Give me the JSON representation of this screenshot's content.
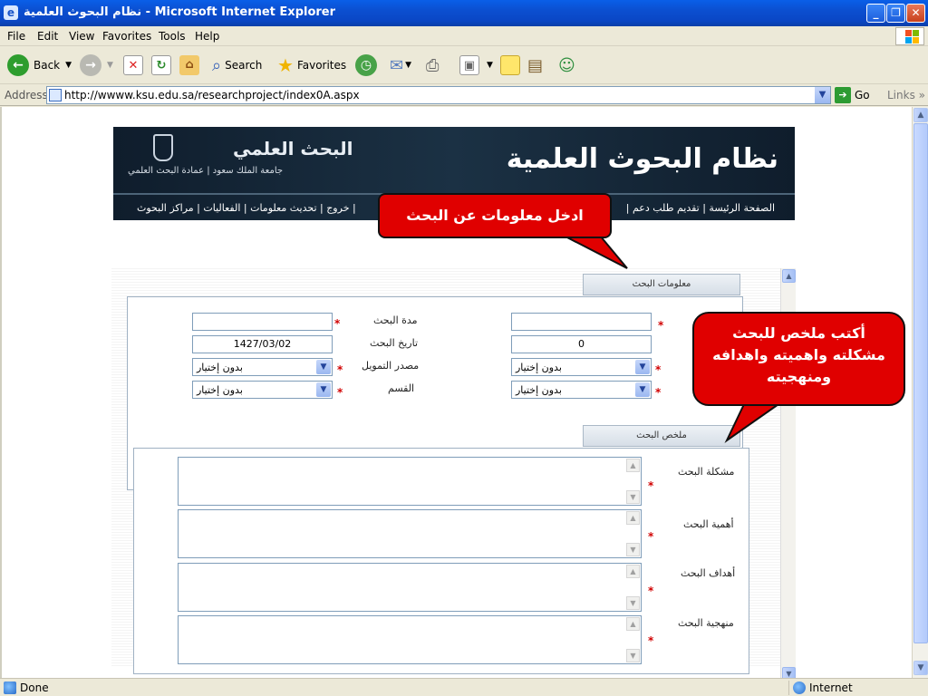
{
  "window": {
    "title": "نظام البحوث العلمية - Microsoft Internet Explorer",
    "minimize_glyph": "_",
    "restore_glyph": "❐",
    "close_glyph": "✕"
  },
  "menu": [
    "File",
    "Edit",
    "View",
    "Favorites",
    "Tools",
    "Help"
  ],
  "toolbar": {
    "back_label": "Back",
    "search_label": "Search",
    "favorites_label": "Favorites"
  },
  "address": {
    "label": "Address",
    "url": "http://wwww.ksu.edu.sa/researchproject/index0A.aspx",
    "go_label": "Go",
    "links_label": "Links"
  },
  "banner": {
    "brand": "نظام البحوث العلمية",
    "research_logo_text": "البحث العلمي",
    "subtitle": "جامعة الملك سعود  |  عمادة البحث العلمي",
    "nav_left": "خروج  |  تحديث معلومات  |  الفعاليات  |  مراكز البحوث  |",
    "nav_right": "الصفحة الرئيسة  |  تقديم طلب دعم  |"
  },
  "section1": {
    "tab_label": "معلومات البحث",
    "fields": {
      "duration_label": "مدة البحث",
      "duration_value": "",
      "date_label": "تاريخ البحث",
      "date_value": "1427/03/02",
      "funding_label": "مصدر التمويل",
      "funding_value": "بدون إختيار",
      "dept_label": "القسم",
      "dept_value": "بدون إختيار",
      "right_text_value": "",
      "right_number_value": "0",
      "right_select1_value": "بدون إختيار",
      "right_select2_value": "بدون إختيار"
    }
  },
  "section2": {
    "tab_label": "ملخص البحث",
    "problem_label": "مشكلة البحث",
    "importance_label": "أهمية البحث",
    "goals_label": "أهداف البحث",
    "method_label": "منهجية البحث"
  },
  "required_mark": "*",
  "callouts": {
    "info": "ادخل معلومات عن البحث",
    "summary_line1": "أكتب ملخص للبحث",
    "summary_line2": "مشكلته واهميته واهدافه",
    "summary_line3": "ومنهجيته"
  },
  "status": {
    "left": "Done",
    "zone": "Internet"
  },
  "colors": {
    "titlebar": "#0a46c4",
    "callout": "#e00000",
    "banner": "#1b3144"
  }
}
